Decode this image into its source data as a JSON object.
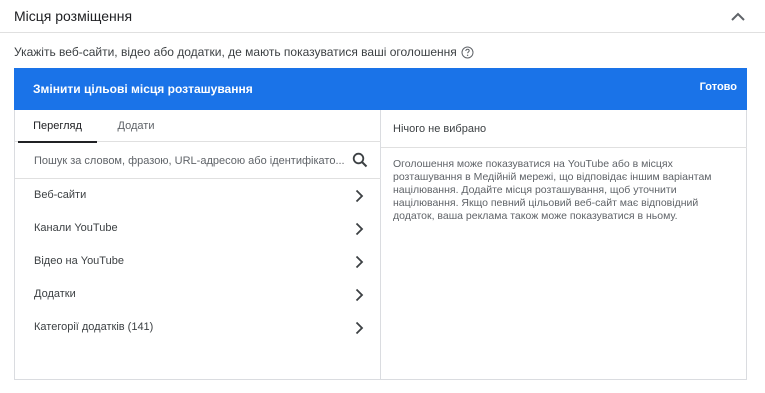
{
  "section": {
    "title": "Місця розміщення",
    "description": "Укажіть веб-сайти, відео або додатки, де мають показуватися ваші оголошення"
  },
  "panel": {
    "title": "Змінити цільові місця розташування",
    "done_label": "Готово"
  },
  "tabs": [
    {
      "label": "Перегляд",
      "active": true
    },
    {
      "label": "Додати",
      "active": false
    }
  ],
  "search": {
    "placeholder": "Пошук за словом, фразою, URL-адресою або ідентифікато...",
    "value": ""
  },
  "categories": [
    {
      "label": "Веб-сайти"
    },
    {
      "label": "Канали YouTube"
    },
    {
      "label": "Відео на YouTube"
    },
    {
      "label": "Додатки"
    },
    {
      "label": "Категорії додатків (141)"
    }
  ],
  "selection": {
    "heading": "Нічого не вибрано",
    "info": "Оголошення може показуватися на YouTube або в місцях розташування в Медійній мережі, що відповідає іншим варіантам націлювання. Додайте місця розташування, щоб уточнити націлювання. Якщо певний цільовий веб-сайт має відповідний додаток, ваша реклама також може показуватися в ньому."
  },
  "colors": {
    "accent": "#1a73e8",
    "text": "#3c4043",
    "border": "#dadce0"
  }
}
